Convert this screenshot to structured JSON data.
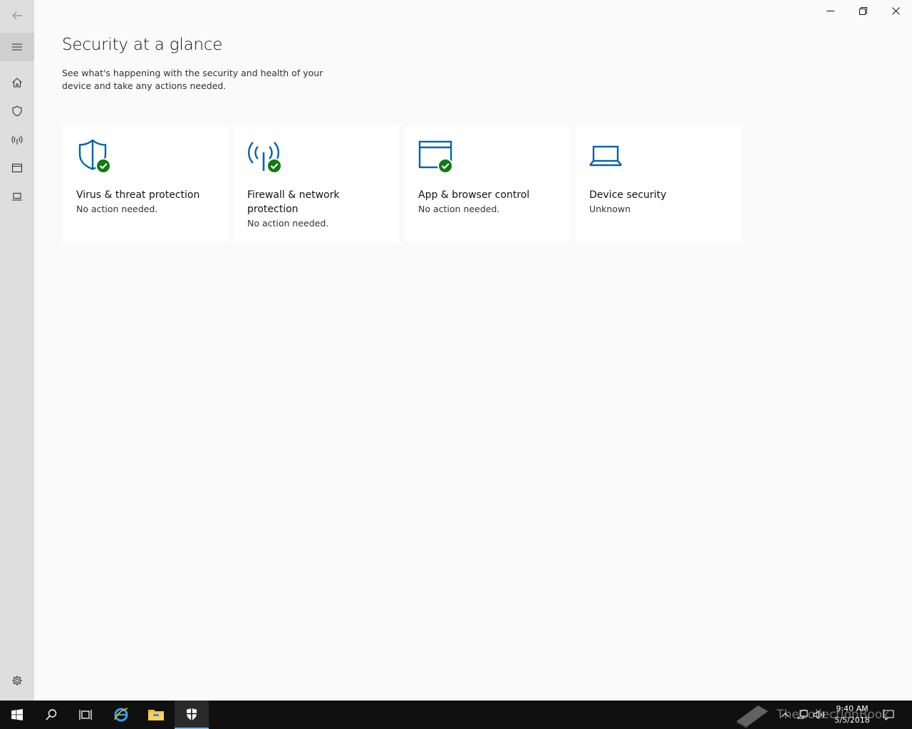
{
  "window": {
    "back_icon": "back-arrow-icon",
    "controls": {
      "minimize": "minimize-icon",
      "restore": "restore-icon",
      "close": "close-icon"
    }
  },
  "sidebar": {
    "items": [
      {
        "icon": "hamburger-menu-icon"
      },
      {
        "icon": "home-icon"
      },
      {
        "icon": "shield-icon"
      },
      {
        "icon": "wireless-icon"
      },
      {
        "icon": "app-window-icon"
      },
      {
        "icon": "laptop-icon"
      },
      {
        "icon": "gear-icon"
      }
    ]
  },
  "main": {
    "title": "Security at a glance",
    "description": "See what's happening with the security and health of your device and take any actions needed."
  },
  "tiles": [
    {
      "title": "Virus & threat protection",
      "status": "No action needed.",
      "icon": "shield-check-icon"
    },
    {
      "title": "Firewall & network protection",
      "status": "No action needed.",
      "icon": "wireless-check-icon"
    },
    {
      "title": "App & browser control",
      "status": "No action needed.",
      "icon": "app-window-check-icon"
    },
    {
      "title": "Device security",
      "status": "Unknown",
      "icon": "laptop-icon"
    }
  ],
  "taskbar": {
    "time": "9:40 AM",
    "date": "5/5/2018",
    "watermark": "TheCollectionBook"
  },
  "colors": {
    "accent": "#0063b1",
    "ok_green": "#107c10",
    "sidebar_bg": "#dedede",
    "taskbar_bg": "#101010"
  }
}
